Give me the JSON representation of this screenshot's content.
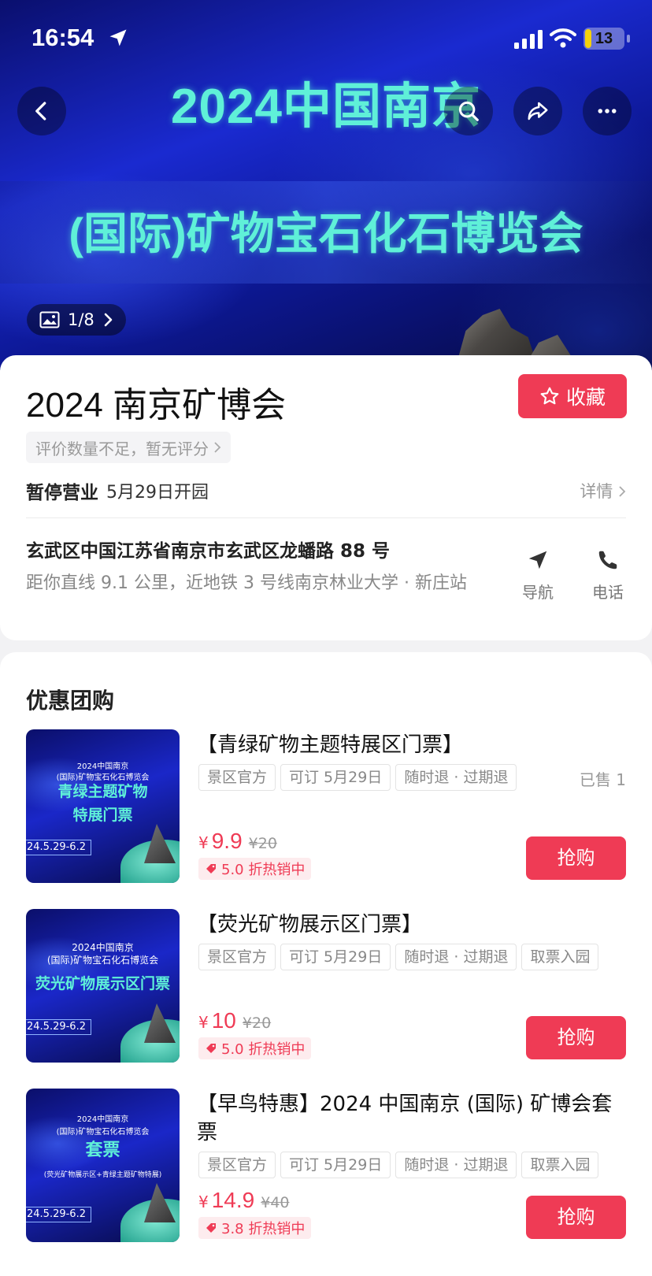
{
  "status_bar": {
    "time": "16:54",
    "battery": "13"
  },
  "hero": {
    "title_line1": "2024中国南京",
    "title_line2": "(国际)矿物宝石化石博览会",
    "image_counter": "1/8"
  },
  "info": {
    "title": "2024 南京矿博会",
    "favorite_label": "收藏",
    "rating_text": "评价数量不足，暂无评分",
    "status_main": "暂停营业",
    "status_sub": "5月29日开园",
    "details_label": "详情",
    "address": "玄武区中国江苏省南京市玄武区龙蟠路 88 号",
    "distance": "距你直线 9.1 公里，近地铁 3 号线南京林业大学 · 新庄站",
    "navigate_label": "导航",
    "phone_label": "电话"
  },
  "deals": {
    "section_title": "优惠团购",
    "items": [
      {
        "name": "【青绿矿物主题特展区门票】",
        "tags": [
          "景区官方",
          "可订 5月29日",
          "随时退 · 过期退"
        ],
        "sold": "已售 1",
        "currency": "¥",
        "price": "9.9",
        "original": "¥20",
        "discount": "5.0 折热销中",
        "buy_label": "抢购",
        "thumb": {
          "line1": "2024中国南京",
          "line2": "(国际)矿物宝石化石博览会",
          "big": "青绿主题矿物\n特展门票",
          "small": "",
          "date": "24.5.29-6.2"
        }
      },
      {
        "name": "【荧光矿物展示区门票】",
        "tags": [
          "景区官方",
          "可订 5月29日",
          "随时退 · 过期退",
          "取票入园"
        ],
        "sold": "",
        "currency": "¥",
        "price": "10",
        "original": "¥20",
        "discount": "5.0 折热销中",
        "buy_label": "抢购",
        "thumb": {
          "line1": "2024中国南京",
          "line2": "(国际)矿物宝石化石博览会",
          "big": "荧光矿物展示区门票",
          "small": "",
          "date": "24.5.29-6.2"
        }
      },
      {
        "name": "【早鸟特惠】2024 中国南京 (国际) 矿博会套票",
        "tags": [
          "景区官方",
          "可订 5月29日",
          "随时退 · 过期退",
          "取票入园"
        ],
        "sold": "",
        "currency": "¥",
        "price": "14.9",
        "original": "¥40",
        "discount": "3.8 折热销中",
        "buy_label": "抢购",
        "thumb": {
          "line1": "2024中国南京",
          "line2": "(国际)矿物宝石化石博览会",
          "big": "套票",
          "small": "(荧光矿物展示区+青绿主题矿物特展)",
          "date": "24.5.29-6.2"
        }
      }
    ]
  }
}
